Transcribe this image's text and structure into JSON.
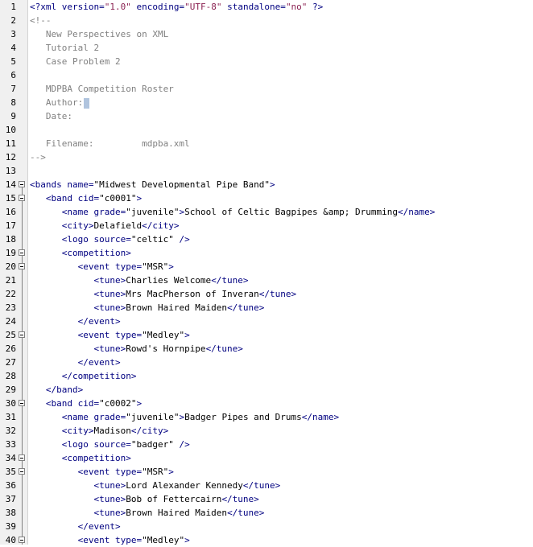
{
  "editor": {
    "file_name": "mdpba.xml"
  },
  "lines": [
    {
      "n": "1",
      "fold": false,
      "tokens": [
        {
          "k": "p",
          "s": "<?xml "
        },
        {
          "k": "a",
          "s": "version="
        },
        {
          "k": "v",
          "s": "\"1.0\""
        },
        {
          "k": "a",
          "s": " encoding="
        },
        {
          "k": "v",
          "s": "\"UTF-8\""
        },
        {
          "k": "a",
          "s": " standalone="
        },
        {
          "k": "v",
          "s": "\"no\""
        },
        {
          "k": "p",
          "s": " ?>"
        }
      ]
    },
    {
      "n": "2",
      "fold": false,
      "tokens": [
        {
          "k": "c",
          "s": "<!--"
        }
      ]
    },
    {
      "n": "3",
      "fold": false,
      "tokens": [
        {
          "k": "c",
          "s": "   New Perspectives on XML"
        }
      ]
    },
    {
      "n": "4",
      "fold": false,
      "tokens": [
        {
          "k": "c",
          "s": "   Tutorial 2"
        }
      ]
    },
    {
      "n": "5",
      "fold": false,
      "tokens": [
        {
          "k": "c",
          "s": "   Case Problem 2"
        }
      ]
    },
    {
      "n": "6",
      "fold": false,
      "tokens": []
    },
    {
      "n": "7",
      "fold": false,
      "tokens": [
        {
          "k": "c",
          "s": "   MDPBA Competition Roster"
        }
      ]
    },
    {
      "n": "8",
      "fold": false,
      "caret": true,
      "tokens": [
        {
          "k": "c",
          "s": "   Author:"
        }
      ]
    },
    {
      "n": "9",
      "fold": false,
      "tokens": [
        {
          "k": "c",
          "s": "   Date:"
        }
      ]
    },
    {
      "n": "10",
      "fold": false,
      "tokens": []
    },
    {
      "n": "11",
      "fold": false,
      "tokens": [
        {
          "k": "c",
          "s": "   Filename:         mdpba.xml"
        }
      ]
    },
    {
      "n": "12",
      "fold": false,
      "tokens": [
        {
          "k": "c",
          "s": "-->"
        }
      ]
    },
    {
      "n": "13",
      "fold": false,
      "tokens": []
    },
    {
      "n": "14",
      "fold": true,
      "tokens": [
        {
          "k": "t",
          "s": "<bands "
        },
        {
          "k": "a",
          "s": "name="
        },
        {
          "k": "x",
          "s": "\"Midwest Developmental Pipe Band\""
        },
        {
          "k": "t",
          "s": ">"
        }
      ]
    },
    {
      "n": "15",
      "fold": true,
      "tokens": [
        {
          "k": "t",
          "s": "   <band "
        },
        {
          "k": "a",
          "s": "cid="
        },
        {
          "k": "x",
          "s": "\"c0001\""
        },
        {
          "k": "t",
          "s": ">"
        }
      ]
    },
    {
      "n": "16",
      "fold": false,
      "tokens": [
        {
          "k": "t",
          "s": "      <name "
        },
        {
          "k": "a",
          "s": "grade="
        },
        {
          "k": "x",
          "s": "\"juvenile\""
        },
        {
          "k": "t",
          "s": ">"
        },
        {
          "k": "x",
          "s": "School of Celtic Bagpipes &amp; Drumming"
        },
        {
          "k": "t",
          "s": "</name>"
        }
      ]
    },
    {
      "n": "17",
      "fold": false,
      "tokens": [
        {
          "k": "t",
          "s": "      <city>"
        },
        {
          "k": "x",
          "s": "Delafield"
        },
        {
          "k": "t",
          "s": "</city>"
        }
      ]
    },
    {
      "n": "18",
      "fold": false,
      "tokens": [
        {
          "k": "t",
          "s": "      <logo "
        },
        {
          "k": "a",
          "s": "source="
        },
        {
          "k": "x",
          "s": "\"celtic\""
        },
        {
          "k": "t",
          "s": " />"
        }
      ]
    },
    {
      "n": "19",
      "fold": true,
      "tokens": [
        {
          "k": "t",
          "s": "      <competition>"
        }
      ]
    },
    {
      "n": "20",
      "fold": true,
      "tokens": [
        {
          "k": "t",
          "s": "         <event "
        },
        {
          "k": "a",
          "s": "type="
        },
        {
          "k": "x",
          "s": "\"MSR\""
        },
        {
          "k": "t",
          "s": ">"
        }
      ]
    },
    {
      "n": "21",
      "fold": false,
      "tokens": [
        {
          "k": "t",
          "s": "            <tune>"
        },
        {
          "k": "x",
          "s": "Charlies Welcome"
        },
        {
          "k": "t",
          "s": "</tune>"
        }
      ]
    },
    {
      "n": "22",
      "fold": false,
      "tokens": [
        {
          "k": "t",
          "s": "            <tune>"
        },
        {
          "k": "x",
          "s": "Mrs MacPherson of Inveran"
        },
        {
          "k": "t",
          "s": "</tune>"
        }
      ]
    },
    {
      "n": "23",
      "fold": false,
      "tokens": [
        {
          "k": "t",
          "s": "            <tune>"
        },
        {
          "k": "x",
          "s": "Brown Haired Maiden"
        },
        {
          "k": "t",
          "s": "</tune>"
        }
      ]
    },
    {
      "n": "24",
      "fold": false,
      "tokens": [
        {
          "k": "t",
          "s": "         </event>"
        }
      ]
    },
    {
      "n": "25",
      "fold": true,
      "tokens": [
        {
          "k": "t",
          "s": "         <event "
        },
        {
          "k": "a",
          "s": "type="
        },
        {
          "k": "x",
          "s": "\"Medley\""
        },
        {
          "k": "t",
          "s": ">"
        }
      ]
    },
    {
      "n": "26",
      "fold": false,
      "tokens": [
        {
          "k": "t",
          "s": "            <tune>"
        },
        {
          "k": "x",
          "s": "Rowd's Hornpipe"
        },
        {
          "k": "t",
          "s": "</tune>"
        }
      ]
    },
    {
      "n": "27",
      "fold": false,
      "tokens": [
        {
          "k": "t",
          "s": "         </event>"
        }
      ]
    },
    {
      "n": "28",
      "fold": false,
      "tokens": [
        {
          "k": "t",
          "s": "      </competition>"
        }
      ]
    },
    {
      "n": "29",
      "fold": false,
      "tokens": [
        {
          "k": "t",
          "s": "   </band>"
        }
      ]
    },
    {
      "n": "30",
      "fold": true,
      "tokens": [
        {
          "k": "t",
          "s": "   <band "
        },
        {
          "k": "a",
          "s": "cid="
        },
        {
          "k": "x",
          "s": "\"c0002\""
        },
        {
          "k": "t",
          "s": ">"
        }
      ]
    },
    {
      "n": "31",
      "fold": false,
      "tokens": [
        {
          "k": "t",
          "s": "      <name "
        },
        {
          "k": "a",
          "s": "grade="
        },
        {
          "k": "x",
          "s": "\"juvenile\""
        },
        {
          "k": "t",
          "s": ">"
        },
        {
          "k": "x",
          "s": "Badger Pipes and Drums"
        },
        {
          "k": "t",
          "s": "</name>"
        }
      ]
    },
    {
      "n": "32",
      "fold": false,
      "tokens": [
        {
          "k": "t",
          "s": "      <city>"
        },
        {
          "k": "x",
          "s": "Madison"
        },
        {
          "k": "t",
          "s": "</city>"
        }
      ]
    },
    {
      "n": "33",
      "fold": false,
      "tokens": [
        {
          "k": "t",
          "s": "      <logo "
        },
        {
          "k": "a",
          "s": "source="
        },
        {
          "k": "x",
          "s": "\"badger\""
        },
        {
          "k": "t",
          "s": " />"
        }
      ]
    },
    {
      "n": "34",
      "fold": true,
      "tokens": [
        {
          "k": "t",
          "s": "      <competition>"
        }
      ]
    },
    {
      "n": "35",
      "fold": true,
      "tokens": [
        {
          "k": "t",
          "s": "         <event "
        },
        {
          "k": "a",
          "s": "type="
        },
        {
          "k": "x",
          "s": "\"MSR\""
        },
        {
          "k": "t",
          "s": ">"
        }
      ]
    },
    {
      "n": "36",
      "fold": false,
      "tokens": [
        {
          "k": "t",
          "s": "            <tune>"
        },
        {
          "k": "x",
          "s": "Lord Alexander Kennedy"
        },
        {
          "k": "t",
          "s": "</tune>"
        }
      ]
    },
    {
      "n": "37",
      "fold": false,
      "tokens": [
        {
          "k": "t",
          "s": "            <tune>"
        },
        {
          "k": "x",
          "s": "Bob of Fettercairn"
        },
        {
          "k": "t",
          "s": "</tune>"
        }
      ]
    },
    {
      "n": "38",
      "fold": false,
      "tokens": [
        {
          "k": "t",
          "s": "            <tune>"
        },
        {
          "k": "x",
          "s": "Brown Haired Maiden"
        },
        {
          "k": "t",
          "s": "</tune>"
        }
      ]
    },
    {
      "n": "39",
      "fold": false,
      "tokens": [
        {
          "k": "t",
          "s": "         </event>"
        }
      ]
    },
    {
      "n": "40",
      "fold": true,
      "tokens": [
        {
          "k": "t",
          "s": "         <event "
        },
        {
          "k": "a",
          "s": "type="
        },
        {
          "k": "x",
          "s": "\"Medley\""
        },
        {
          "k": "t",
          "s": ">"
        }
      ]
    }
  ],
  "colors": {
    "tag": "#000080",
    "comment": "#808080",
    "value": "#8b2252",
    "gutter": "#f0f0f0"
  }
}
